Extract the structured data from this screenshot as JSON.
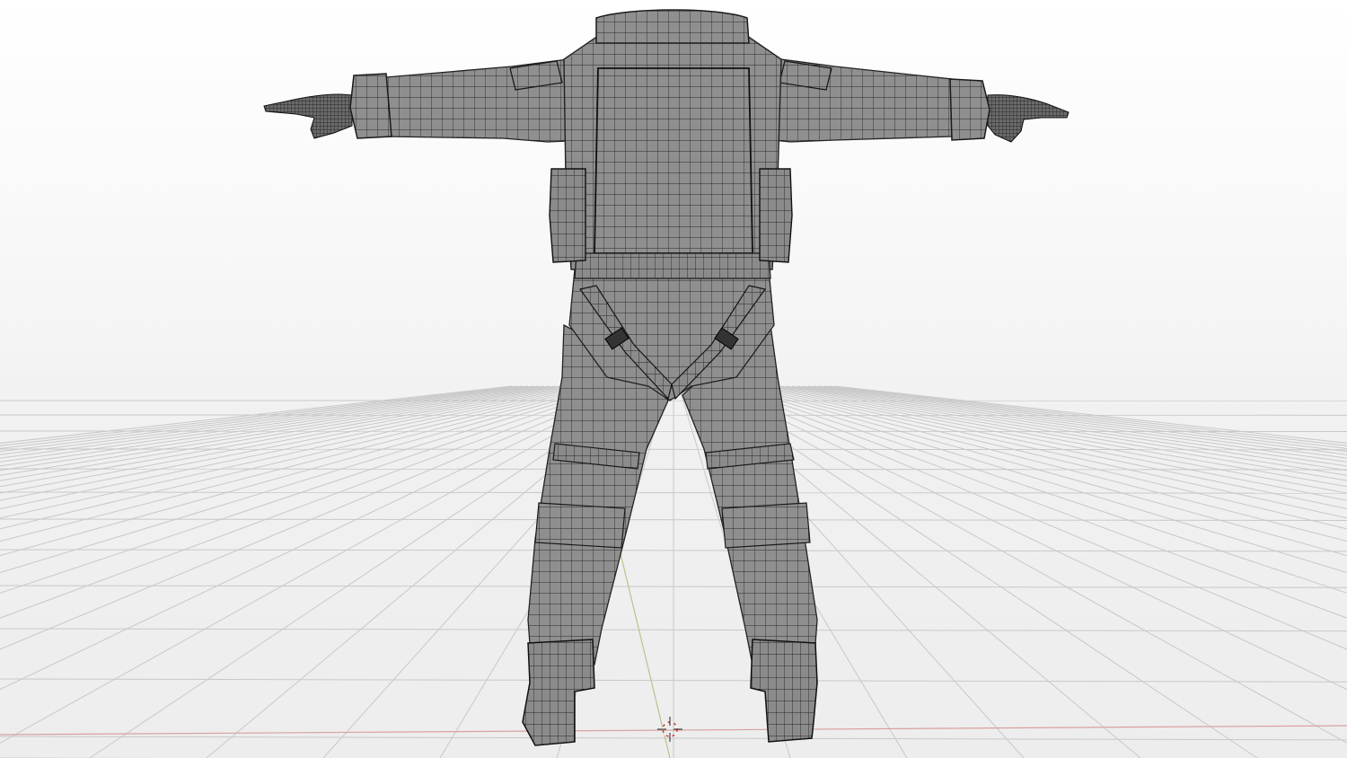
{
  "viewport": {
    "view": "back-orthographic",
    "shading": "solid-wireframe",
    "background_color": "#f4f4f4",
    "grid_line_color": "#c8c8c8",
    "mesh_fill_color": "#8f8f8f",
    "mesh_wire_color": "#2a2a2a",
    "x_axis_color": "#d8a0a0",
    "y_axis_color": "#b9c48a"
  },
  "icons": {
    "cursor": "3d-cursor-icon"
  }
}
